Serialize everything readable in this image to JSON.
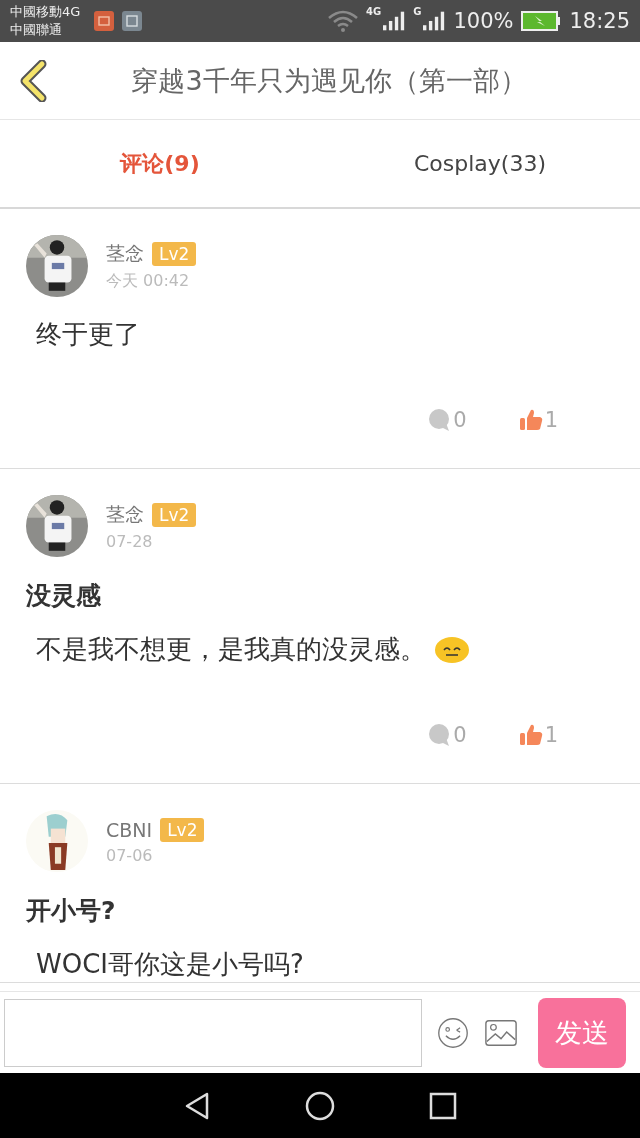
{
  "status_bar": {
    "carriers": [
      "中國移動4G",
      "中國聯通"
    ],
    "network_labels": [
      "4G",
      "G"
    ],
    "battery": "100%",
    "time": "18:25"
  },
  "header": {
    "title": "穿越3千年只为遇见你（第一部）"
  },
  "tabs": [
    {
      "label": "评论(9)",
      "selected": true
    },
    {
      "label": "Cosplay(33)",
      "selected": false
    }
  ],
  "comments": [
    {
      "user": "茎念",
      "level": "Lv2",
      "time": "今天 00:42",
      "body": "终于更了",
      "emoji": false,
      "replies": "0",
      "likes": "1"
    },
    {
      "user": "茎念",
      "level": "Lv2",
      "time": "07-28",
      "title": "没灵感",
      "body": "不是我不想更，是我真的没灵感。",
      "emoji": true,
      "replies": "0",
      "likes": "1"
    },
    {
      "user": "CBNI",
      "level": "Lv2",
      "time": "07-06",
      "title": "开小号?",
      "body": "WOCI哥你这是小号吗?",
      "emoji": false
    }
  ],
  "composer": {
    "send": "发送"
  }
}
